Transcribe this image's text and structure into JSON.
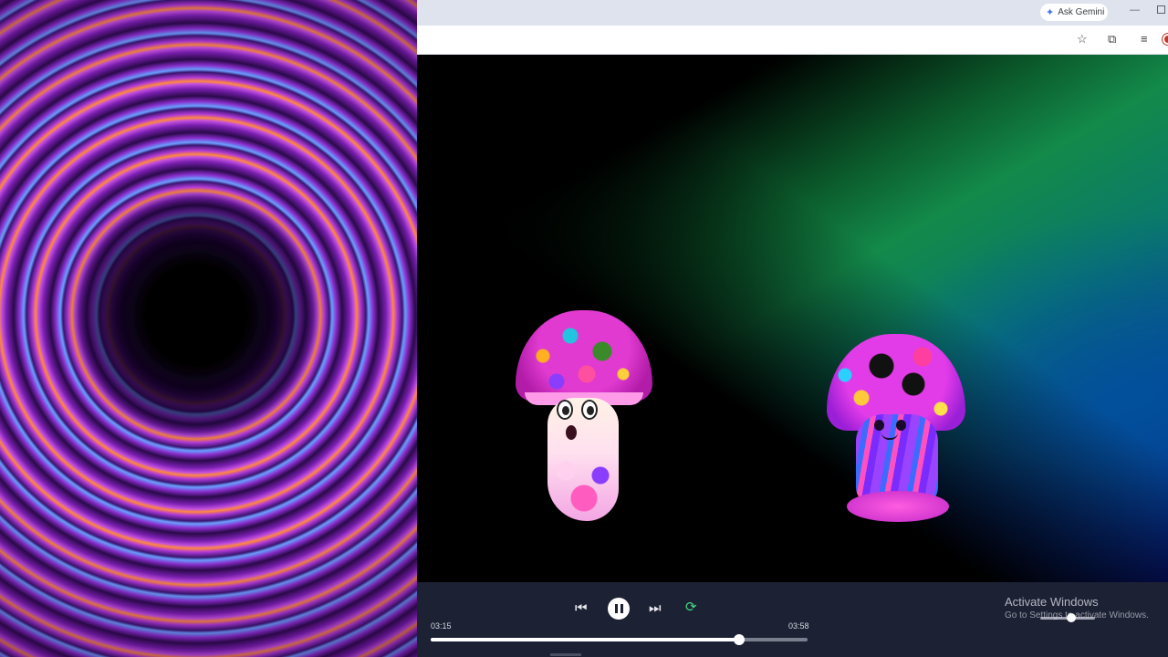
{
  "browser": {
    "gemini_label": "Ask Gemini",
    "gemini_icon": "sparkle-icon",
    "toolbar_icons": [
      "star-icon",
      "extensions-icon",
      "media-list-icon",
      "profile-icon"
    ],
    "window_controls": [
      "minimize-icon",
      "maximize-icon"
    ]
  },
  "player": {
    "current_time": "03:15",
    "total_time": "03:58",
    "progress": 0.8193,
    "state": "playing",
    "controls": [
      "previous-icon",
      "pause-icon",
      "next-icon",
      "repeat-icon"
    ],
    "repeat_color": "#3ddc84",
    "volume": 0.48
  },
  "watermark": {
    "line1": "Activate Windows",
    "line2": "Go to Settings to activate Windows."
  },
  "colors": {
    "player_bg": "#1c2133",
    "chrome_bg": "#dfe3ee"
  }
}
